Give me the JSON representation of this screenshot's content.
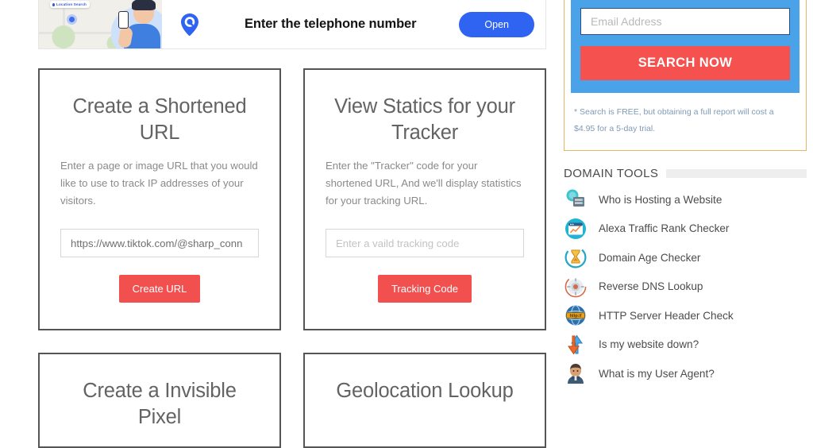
{
  "promo": {
    "art_chip_label": "Location Search",
    "pin_icon": "location-pin-icon",
    "headline": "Enter the telephone number",
    "open_label": "Open"
  },
  "cards": [
    {
      "title": "Create a Shortened URL",
      "description": "Enter a page or image URL that you would like to use to track IP addresses of your visitors.",
      "input_value": "https://www.tiktok.com/@sharp_conn",
      "input_placeholder": "",
      "button_label": "Create URL"
    },
    {
      "title": "View Statics for your Tracker",
      "description": "Enter the \"Tracker\" code for your shortened URL, And we'll display statistics for your tracking URL.",
      "input_value": "",
      "input_placeholder": "Enter a vaild tracking code",
      "button_label": "Tracking Code"
    }
  ],
  "cards_row2": [
    {
      "title": "Create a Invisible Pixel"
    },
    {
      "title": "Geolocation Lookup"
    }
  ],
  "sidebar": {
    "search": {
      "email_placeholder": "Email Address",
      "email_value": "",
      "button_label": "SEARCH NOW",
      "note": "* Search is FREE, but obtaining a full report will cost a $4.95 for a 5-day trial."
    },
    "domain_tools": {
      "heading": "DOMAIN TOOLS",
      "items": [
        {
          "label": "Who is Hosting a Website",
          "icon": "server-hosting-icon"
        },
        {
          "label": "Alexa Traffic Rank Checker",
          "icon": "traffic-chart-icon"
        },
        {
          "label": "Domain Age Checker",
          "icon": "hourglass-icon"
        },
        {
          "label": "Reverse DNS Lookup",
          "icon": "dns-gear-icon"
        },
        {
          "label": "HTTP Server Header Check",
          "icon": "http-globe-icon"
        },
        {
          "label": "Is my website down?",
          "icon": "up-down-arrows-icon"
        },
        {
          "label": "What is my User Agent?",
          "icon": "user-agent-icon"
        }
      ]
    }
  },
  "colors": {
    "accent_red": "#f1504f",
    "promo_blue": "#2f63f2",
    "panel_blue": "#4aa3e8",
    "panel_border": "#e0b867",
    "card_border": "#555555"
  }
}
